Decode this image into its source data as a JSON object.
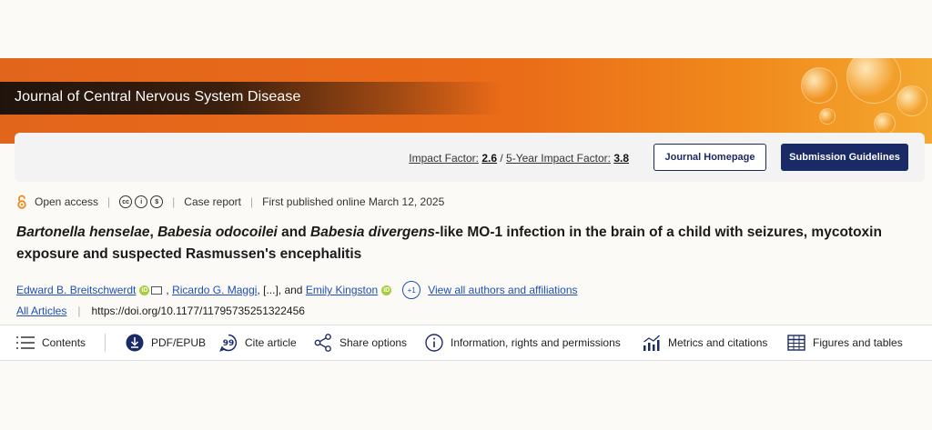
{
  "journal": {
    "title": "Journal of Central Nervous System Disease"
  },
  "metrics_bar": {
    "impact_factor_label": "Impact Factor:",
    "impact_factor_value": "2.6",
    "separator": "/",
    "five_year_label": "5-Year Impact Factor:",
    "five_year_value": "3.8",
    "homepage_button": "Journal Homepage",
    "submission_button": "Submission Guidelines"
  },
  "meta": {
    "access": "Open access",
    "license_icons": [
      "cc-icon",
      "by-icon",
      "nc-icon"
    ],
    "license_glyphs": [
      "cc",
      "i",
      "$"
    ],
    "type": "Case report",
    "published": "First published online March 12, 2025"
  },
  "article": {
    "title_parts": [
      {
        "text": "Bartonella henselae",
        "italic": true
      },
      {
        "text": ", ",
        "italic": false
      },
      {
        "text": "Babesia odocoilei",
        "italic": true
      },
      {
        "text": " and ",
        "italic": false
      },
      {
        "text": "Babesia divergens",
        "italic": true
      },
      {
        "text": "-like MO-1 infection in the brain of a child with seizures, mycotoxin exposure and suspected Rasmussen's encephalitis",
        "italic": false
      }
    ]
  },
  "authors": {
    "author1": "Edward B. Breitschwerdt",
    "comma": ",",
    "author2": "Ricardo G. Maggi",
    "ellipsis": ", [...], and",
    "author3": "Emily Kingston",
    "more_count": "+1",
    "view_all": "View all authors and affiliations"
  },
  "doi": {
    "section": "All Articles",
    "url": "https://doi.org/10.1177/11795735251322456"
  },
  "toolbar": {
    "contents": "Contents",
    "pdf": "PDF/EPUB",
    "cite": "Cite article",
    "share": "Share options",
    "info": "Information, rights and permissions",
    "metrics": "Metrics and citations",
    "figures": "Figures and tables"
  },
  "colors": {
    "banner_orange": "#ea6b18",
    "navy": "#1a2a66",
    "link_blue": "#1f4fb5",
    "orcid_green": "#a6ce39",
    "open_access_orange": "#f08a1c"
  }
}
